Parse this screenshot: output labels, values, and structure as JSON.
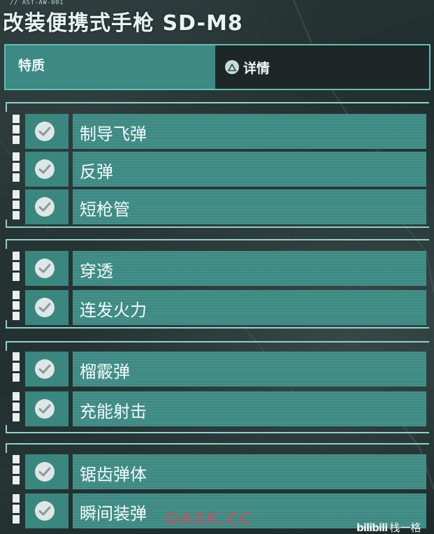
{
  "header": {
    "code": "// AST-AW-001",
    "title": "改装便携式手枪 SD-M8"
  },
  "tabs": {
    "traits_label": "特质",
    "details_label": "详情",
    "details_icon": "triangle-button-icon"
  },
  "groups": [
    {
      "items": [
        {
          "label": "制导飞弹",
          "checked": true
        },
        {
          "label": "反弹",
          "checked": true
        },
        {
          "label": "短枪管",
          "checked": true
        }
      ]
    },
    {
      "items": [
        {
          "label": "穿透",
          "checked": true
        },
        {
          "label": "连发火力",
          "checked": true
        }
      ]
    },
    {
      "items": [
        {
          "label": "榴霰弹",
          "checked": true
        },
        {
          "label": "充能射击",
          "checked": true
        }
      ]
    },
    {
      "items": [
        {
          "label": "锯齿弹体",
          "checked": true
        },
        {
          "label": "瞬间装弹",
          "checked": true
        }
      ]
    }
  ],
  "watermark": "GASK.CC",
  "source_badge": {
    "logo": "bilibili",
    "text": "栈一格"
  },
  "colors": {
    "accent": "#3f8d86",
    "frame": "#8fd3cc",
    "text": "#f4fbfa"
  }
}
